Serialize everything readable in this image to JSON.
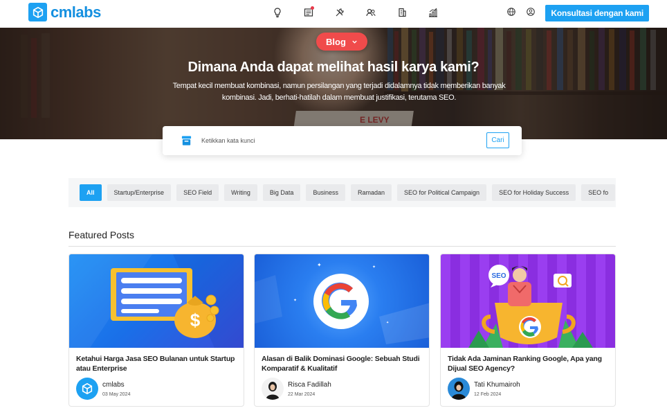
{
  "brand": {
    "name": "cmlabs",
    "color": "#1da1f2"
  },
  "nav": {
    "icons": [
      "lightbulb-icon",
      "newspaper-icon",
      "tools-icon",
      "users-icon",
      "building-icon",
      "chart-icon"
    ],
    "cta_label": "Konsultasi dengan kami"
  },
  "hero": {
    "pill_label": "Blog",
    "title": "Dimana Anda dapat melihat hasil karya kami?",
    "subtitle": "Tempat kecil membuat kombinasi, namun persilangan yang terjadi didalamnya tidak memberikan banyak kombinasi. Jadi, berhati-hatilah dalam membuat justifikasi, terutama SEO.",
    "book_text": "E LEVY"
  },
  "search": {
    "placeholder": "Ketikkan kata kunci",
    "button_label": "Cari"
  },
  "filters": {
    "chips": [
      "All",
      "Startup/Enterprise",
      "SEO Field",
      "Writing",
      "Big Data",
      "Business",
      "Ramadan",
      "SEO for Political Campaign",
      "SEO for Holiday Success",
      "SEO fo"
    ],
    "active_index": 0
  },
  "featured": {
    "title": "Featured Posts",
    "posts": [
      {
        "title": "Ketahui Harga Jasa SEO Bulanan untuk Startup atau Enterprise",
        "author": "cmlabs",
        "date": "03 May 2024"
      },
      {
        "title": "Alasan di Balik Dominasi Google: Sebuah Studi Komparatif & Kualitatif",
        "author": "Risca Fadillah",
        "date": "22 Mar 2024"
      },
      {
        "title": "Tidak Ada Jaminan Ranking Google, Apa yang Dijual SEO Agency?",
        "author": "Tati Khumairoh",
        "date": "12 Feb 2024"
      }
    ],
    "image_labels": {
      "seo_bubble": "SEO"
    }
  }
}
